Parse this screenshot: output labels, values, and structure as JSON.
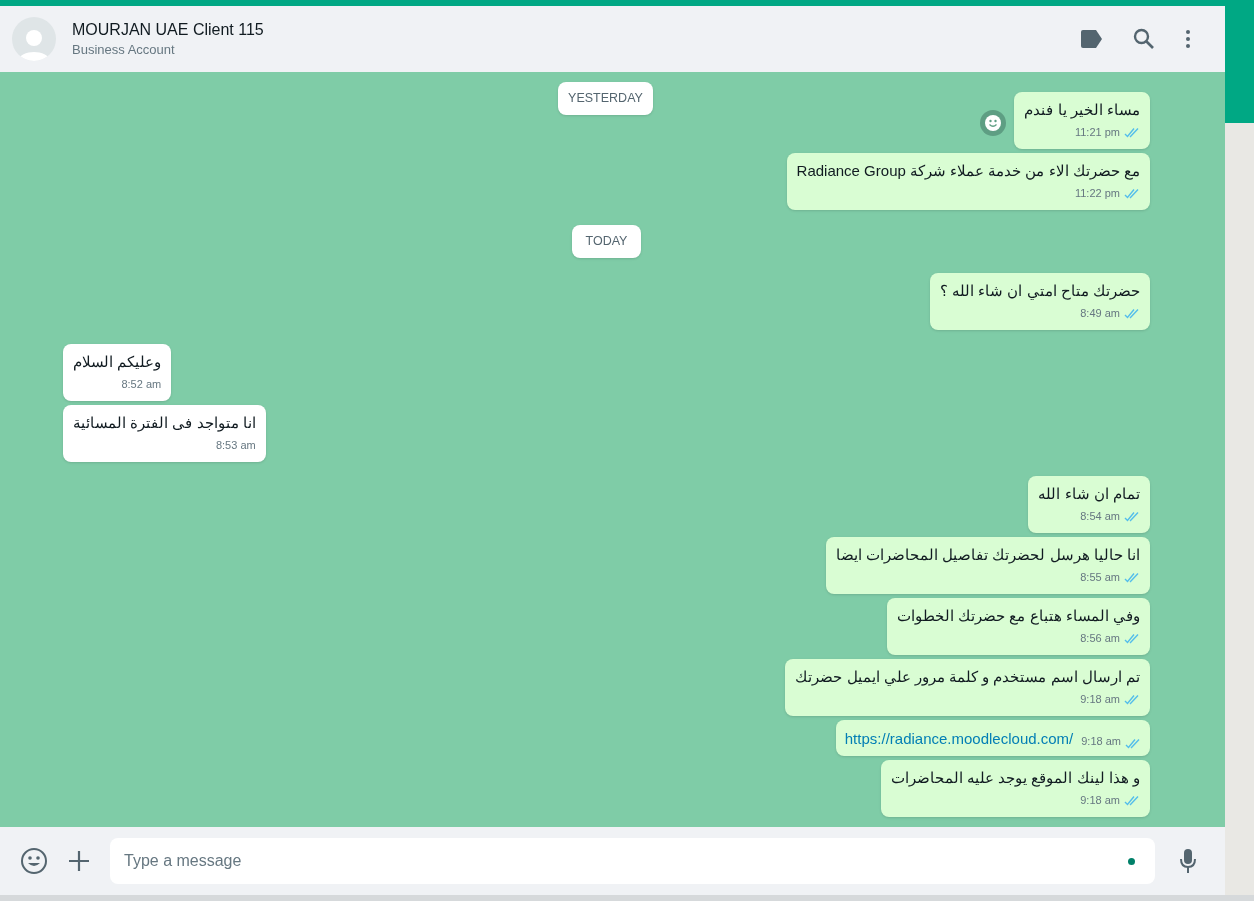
{
  "header": {
    "title": "MOURJAN UAE Client 115",
    "subtitle": "Business Account"
  },
  "sticky_date": "YESTERDAY",
  "messages": [
    {
      "kind": "out",
      "text": "مساء الخير يا فندم",
      "time": "11:21 pm",
      "read": true,
      "reaction_button": true
    },
    {
      "kind": "out",
      "text": "مع حضرتك الاء من خدمة عملاء شركة Radiance Group",
      "time": "11:22 pm",
      "read": true
    },
    {
      "kind": "date",
      "text": "TODAY"
    },
    {
      "kind": "out",
      "text": "حضرتك متاح امتي ان شاء الله ؟",
      "time": "8:49 am",
      "read": true
    },
    {
      "kind": "in",
      "text": "وعليكم السلام",
      "time": "8:52 am"
    },
    {
      "kind": "in",
      "text": "انا متواجد فى الفترة المسائية",
      "time": "8:53 am"
    },
    {
      "kind": "out",
      "text": "تمام ان شاء الله",
      "time": "8:54 am",
      "read": true
    },
    {
      "kind": "out",
      "text": "انا حاليا هرسل لحضرتك تفاصيل المحاضرات ايضا",
      "time": "8:55 am",
      "read": true
    },
    {
      "kind": "out",
      "text": "وفي المساء هتباع مع حضرتك الخطوات",
      "time": "8:56 am",
      "read": true
    },
    {
      "kind": "out",
      "text": "تم ارسال اسم مستخدم و كلمة مرور علي ايميل حضرتك",
      "time": "9:18 am",
      "read": true
    },
    {
      "kind": "link",
      "text": "https://radiance.moodlecloud.com/",
      "time": "9:18 am",
      "read": true
    },
    {
      "kind": "out",
      "text": "و هذا لينك الموقع يوجد عليه المحاضرات",
      "time": "9:18 am",
      "read": true
    }
  ],
  "composer": {
    "placeholder": "Type a message"
  }
}
